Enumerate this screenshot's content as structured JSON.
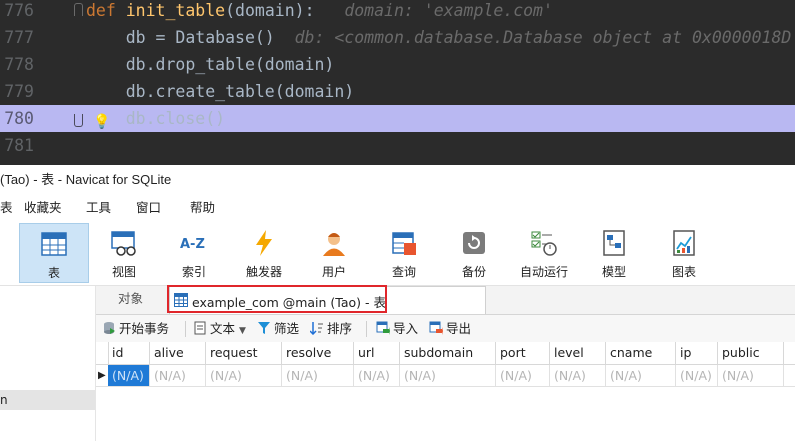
{
  "editor": {
    "lines": [
      {
        "no": "776",
        "segments": [
          {
            "t": "def ",
            "c": "kw"
          },
          {
            "t": "init_table",
            "c": "fn"
          },
          {
            "t": "(",
            "c": "param"
          },
          {
            "t": "domain",
            "c": "param"
          },
          {
            "t": "):",
            "c": "param"
          },
          {
            "t": "   domain: 'example.com'",
            "c": "hint"
          }
        ]
      },
      {
        "no": "777",
        "segments": [
          {
            "t": "    db = Database()",
            "c": "cls"
          },
          {
            "t": "  db: <common.database.Database object at 0x0000018D",
            "c": "hint"
          }
        ]
      },
      {
        "no": "778",
        "segments": [
          {
            "t": "    db.drop_table(domain)",
            "c": "method"
          }
        ]
      },
      {
        "no": "779",
        "segments": [
          {
            "t": "    db.create_table(domain)",
            "c": "method"
          }
        ]
      },
      {
        "no": "780",
        "segments": [
          {
            "t": "    db.close()",
            "c": "method"
          }
        ]
      },
      {
        "no": "781",
        "segments": []
      }
    ]
  },
  "window": {
    "title": "(Tao) - 表 - Navicat for SQLite"
  },
  "menu": [
    "表",
    "收藏夹",
    "工具",
    "窗口",
    "帮助"
  ],
  "toolbar": [
    {
      "label": "表",
      "icon": "table-icon",
      "active": true
    },
    {
      "label": "视图",
      "icon": "view-icon"
    },
    {
      "label": "索引",
      "icon": "index-icon"
    },
    {
      "label": "触发器",
      "icon": "trigger-icon"
    },
    {
      "label": "用户",
      "icon": "user-icon"
    },
    {
      "label": "查询",
      "icon": "query-icon"
    },
    {
      "label": "备份",
      "icon": "backup-icon"
    },
    {
      "label": "自动运行",
      "icon": "auto-run-icon"
    },
    {
      "label": "模型",
      "icon": "model-icon"
    },
    {
      "label": "图表",
      "icon": "chart-icon"
    }
  ],
  "sidebar": {
    "selected_label": "n"
  },
  "tabs": {
    "objects": "对象",
    "active_table": "example_com @main (Tao) - 表"
  },
  "actions": {
    "begin_transaction": "开始事务",
    "text": "文本",
    "filter": "筛选",
    "sort": "排序",
    "import": "导入",
    "export": "导出"
  },
  "table": {
    "columns": [
      "id",
      "alive",
      "request",
      "resolve",
      "url",
      "subdomain",
      "port",
      "level",
      "cname",
      "ip",
      "public"
    ],
    "rows": [
      [
        "(N/A)",
        "(N/A)",
        "(N/A)",
        "(N/A)",
        "(N/A)",
        "(N/A)",
        "(N/A)",
        "(N/A)",
        "(N/A)",
        "(N/A)",
        "(N/A)"
      ]
    ]
  }
}
